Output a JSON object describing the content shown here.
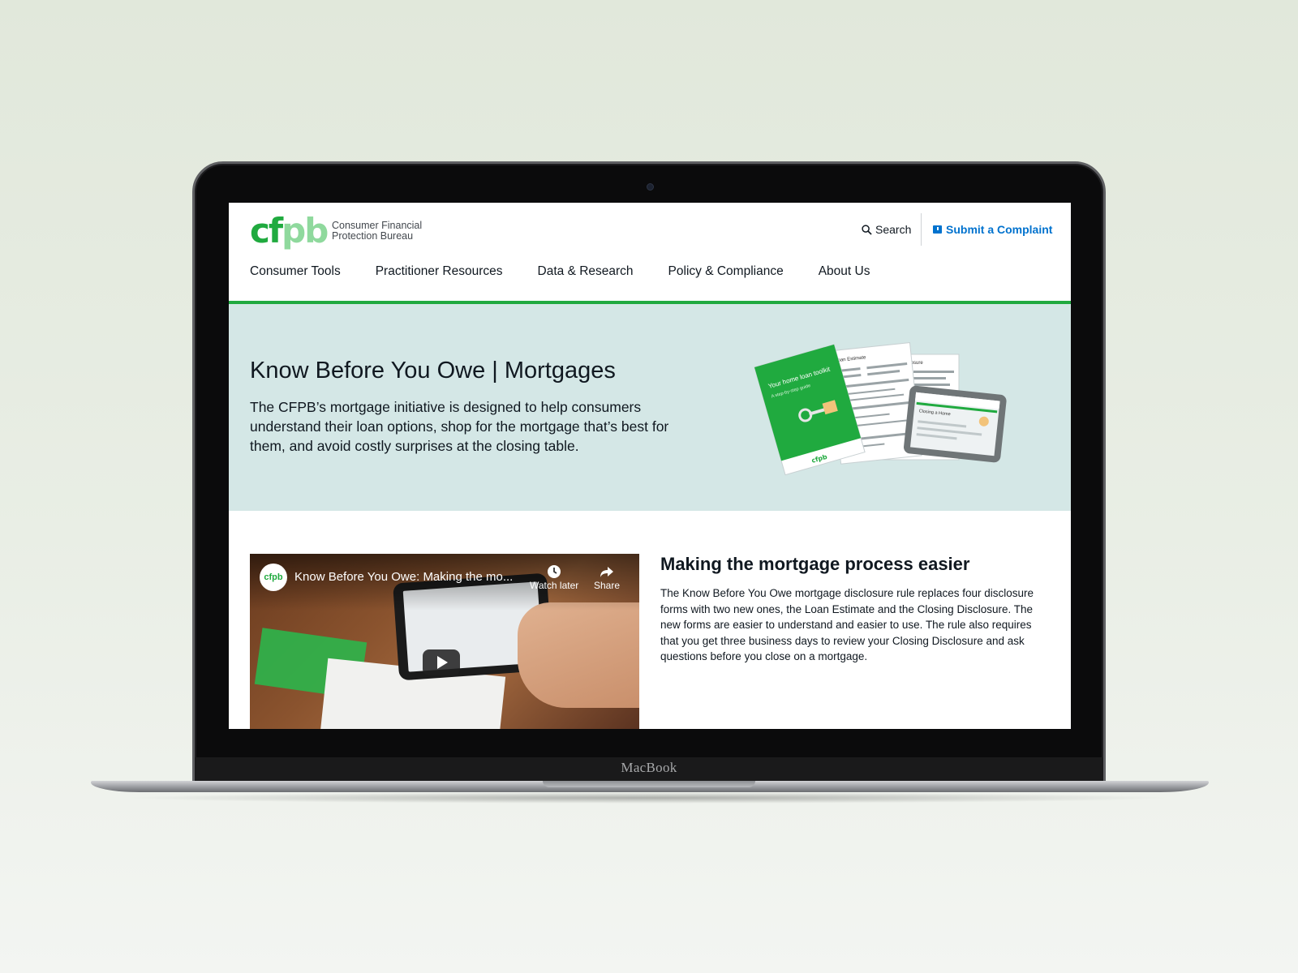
{
  "device": {
    "brand_label": "MacBook"
  },
  "header": {
    "logo_mark_main": "cf",
    "logo_mark_accent": "pb",
    "logo_line1": "Consumer Financial",
    "logo_line2": "Protection Bureau",
    "search_label": "Search",
    "complaint_label": "Submit a Complaint",
    "accent_color": "#20aa3f",
    "link_color": "#0072ce"
  },
  "nav": {
    "items": [
      {
        "label": "Consumer Tools"
      },
      {
        "label": "Practitioner Resources"
      },
      {
        "label": "Data & Research"
      },
      {
        "label": "Policy & Compliance"
      },
      {
        "label": "About Us"
      }
    ]
  },
  "hero": {
    "title": "Know Before You Owe | Mortgages",
    "description": "The CFPB’s mortgage initiative is designed to help consumers understand their loan options, shop for the mortgage that’s best for them, and avoid costly surprises at the closing table.",
    "background_color": "#d4e7e6",
    "illustration": {
      "toolkit_title": "Your home loan toolkit",
      "toolkit_subtitle": "A step-by-step guide",
      "toolkit_logo": "cfpb",
      "form1_title": "Loan Estimate",
      "form2_title": "Closing Disclosure",
      "tablet_label": "Closing a Home"
    }
  },
  "video": {
    "channel_avatar": "cfpb",
    "title": "Know Before You Owe: Making the mo...",
    "watch_later_label": "Watch later",
    "share_label": "Share"
  },
  "section": {
    "title": "Making the mortgage process easier",
    "body": "The Know Before You Owe mortgage disclosure rule replaces four disclosure forms with two new ones, the Loan Estimate and the Closing Disclosure. The new forms are easier to understand and easier to use. The rule also requires that you get three business days to review your Closing Disclosure and ask questions before you close on a mortgage."
  }
}
